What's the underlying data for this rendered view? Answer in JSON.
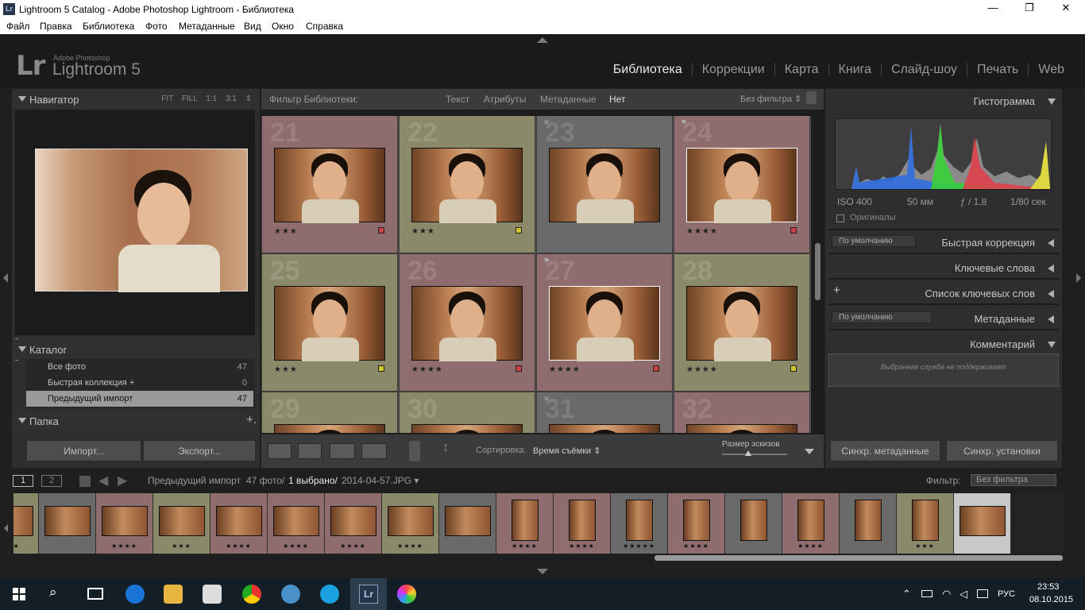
{
  "window": {
    "title": "Lightroom 5 Catalog - Adobe Photoshop Lightroom - Библиотека",
    "app_icon": "Lr",
    "minimize": "—",
    "maximize": "❐",
    "close": "✕"
  },
  "menu": [
    "Файл",
    "Правка",
    "Библиотека",
    "Фото",
    "Метаданные",
    "Вид",
    "Окно",
    "Справка"
  ],
  "logo": {
    "mark": "Lr",
    "small": "Adobe Photoshop",
    "big": "Lightroom 5"
  },
  "modules": [
    "Библиотека",
    "Коррекции",
    "Карта",
    "Книга",
    "Слайд-шоу",
    "Печать",
    "Web"
  ],
  "navigator": {
    "title": "Навигатор",
    "opts": "FIT FILL 1:1 3:1 ⇕"
  },
  "catalog": {
    "title": "Каталог",
    "items": [
      {
        "label": "Все фото",
        "count": "47"
      },
      {
        "label": "Быстрая коллекция +",
        "count": "0"
      },
      {
        "label": "Предыдущий импорт",
        "count": "47"
      }
    ]
  },
  "folders": {
    "title": "Папка",
    "plus": "+."
  },
  "buttons": {
    "import": "Импорт...",
    "export": "Экспорт...",
    "sync_meta": "Синхр. метаданные",
    "sync_settings": "Синхр. установки"
  },
  "filterbar": {
    "label": "Фильтр Библиотеки:",
    "text": "Текст",
    "attr": "Атрибуты",
    "meta": "Метаданные",
    "none": "Нет",
    "preset": "Без фильтра ⇕"
  },
  "grid": [
    {
      "num": "21",
      "stars": "★★★",
      "color": "#c94040",
      "bg": "#8f6c6e",
      "flag": "",
      "sel": false
    },
    {
      "num": "22",
      "stars": "★★★",
      "color": "#d2c52e",
      "bg": "#8a8a6b",
      "flag": "",
      "sel": false
    },
    {
      "num": "23",
      "stars": "",
      "color": "",
      "bg": "#6a6a6a",
      "flag": "✕",
      "sel": false
    },
    {
      "num": "24",
      "stars": "★★★★",
      "color": "#c94040",
      "bg": "#8f6c6e",
      "flag": "⚑",
      "sel": true
    },
    {
      "num": "25",
      "stars": "★★★",
      "color": "#d2c52e",
      "bg": "#8a8a6b",
      "flag": "",
      "sel": false
    },
    {
      "num": "26",
      "stars": "★★★★",
      "color": "#c94040",
      "bg": "#8f6c6e",
      "flag": "",
      "sel": false
    },
    {
      "num": "27",
      "stars": "★★★★",
      "color": "#c94040",
      "bg": "#8f6c6e",
      "flag": "⚑",
      "sel": true
    },
    {
      "num": "28",
      "stars": "★★★★",
      "color": "#d2c52e",
      "bg": "#8a8a6b",
      "flag": "",
      "sel": false
    },
    {
      "num": "29",
      "stars": "",
      "color": "",
      "bg": "#8a8a6b",
      "flag": "",
      "sel": false
    },
    {
      "num": "30",
      "stars": "",
      "color": "",
      "bg": "#8a8a6b",
      "flag": "",
      "sel": false
    },
    {
      "num": "31",
      "stars": "",
      "color": "",
      "bg": "#6a6a6a",
      "flag": "✕",
      "sel": false
    },
    {
      "num": "32",
      "stars": "",
      "color": "",
      "bg": "#8f6c6e",
      "flag": "",
      "sel": false
    }
  ],
  "toolbar": {
    "sort_label": "Сортировка:",
    "sort_value": "Время съёмки ⇕",
    "thumb_label": "Размер эскизов",
    "thumb_level": 0.4
  },
  "right": {
    "histogram": "Гистограмма",
    "exif": {
      "iso": "ISO 400",
      "focal": "50 мм",
      "aperture": "ƒ / 1,8",
      "shutter": "1/80 сек"
    },
    "originals": "Оригиналы",
    "default1": "По умолчанию",
    "quick": "Быстрая коррекция",
    "keywords": "Ключевые слова",
    "kwlist": "Список ключевых слов",
    "default2": "По умолчанию",
    "metadata": "Метаданные",
    "comments": "Комментарий",
    "comment_text": "Выбранная служба не поддерживает"
  },
  "filmbar": {
    "p1": "1",
    "p2": "2",
    "source": "Предыдущий импорт",
    "count": "47 фото/",
    "selected": "1 выбрано/",
    "file": "2014-04-57.JPG ▾",
    "filter_label": "Фильтр:",
    "filter_value": "Без фильтра"
  },
  "film": [
    {
      "bg": "#8a8a6b",
      "s": "★★★"
    },
    {
      "bg": "#6a6a6a",
      "s": ""
    },
    {
      "bg": "#8f6c6e",
      "s": "★★★★"
    },
    {
      "bg": "#8a8a6b",
      "s": "★★★"
    },
    {
      "bg": "#8f6c6e",
      "s": "★★★★"
    },
    {
      "bg": "#8f6c6e",
      "s": "★★★★"
    },
    {
      "bg": "#8f6c6e",
      "s": "★★★★"
    },
    {
      "bg": "#8a8a6b",
      "s": "★★★★"
    },
    {
      "bg": "#6a6a6a",
      "s": ""
    },
    {
      "bg": "#8f6c6e",
      "s": "★★★★"
    },
    {
      "bg": "#8f6c6e",
      "s": "★★★★"
    },
    {
      "bg": "#6a6a6a",
      "s": "★★★★★"
    },
    {
      "bg": "#8f6c6e",
      "s": "★★★★"
    },
    {
      "bg": "#6a6a6a",
      "s": ""
    },
    {
      "bg": "#8f6c6e",
      "s": "★★★★"
    },
    {
      "bg": "#6a6a6a",
      "s": ""
    },
    {
      "bg": "#8a8a6b",
      "s": "★★★"
    },
    {
      "bg": "#c8c8c8",
      "s": ""
    }
  ],
  "taskbar": {
    "lang": "РУС",
    "time": "23:53",
    "date": "08.10.2015"
  }
}
